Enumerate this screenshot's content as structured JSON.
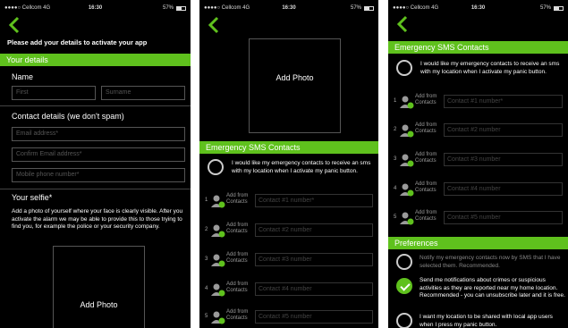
{
  "status": {
    "carrier": "●●●●○ Cellcom  4G",
    "time": "16:30",
    "battery": "57%"
  },
  "screen1": {
    "instruction": "Please add your details to activate your app",
    "details_header": "Your details",
    "name_label": "Name",
    "first_placeholder": "First",
    "surname_placeholder": "Surname",
    "contact_label": "Contact details (we don't spam)",
    "email_placeholder": "Email address*",
    "confirm_email_placeholder": "Confirm Email address*",
    "mobile_placeholder": "Mobile phone number*",
    "selfie_label": "Your selfie*",
    "selfie_text": "Add a photo of yourself where your face is clearly visible. After you activate the alarm we may be able to provide this to those trying to find you, for example the police or your security company.",
    "add_photo": "Add Photo"
  },
  "screen2": {
    "add_photo": "Add Photo",
    "sms_header": "Emergency SMS Contacts",
    "sms_option": "I would like my emergency contacts to receive an sms with my location when I activate my panic button.",
    "add_from": "Add from",
    "contacts": "Contacts",
    "contact_rows": [
      {
        "num": "1",
        "placeholder": "Contact #1 number*"
      },
      {
        "num": "2",
        "placeholder": "Contact #2 number"
      },
      {
        "num": "3",
        "placeholder": "Contact #3 number"
      },
      {
        "num": "4",
        "placeholder": "Contact #4 number"
      },
      {
        "num": "5",
        "placeholder": "Contact #5 number"
      }
    ]
  },
  "screen3": {
    "sms_header": "Emergency SMS Contacts",
    "sms_option": "I would like my emergency contacts to receive an sms with my location when I activate my panic button.",
    "add_from": "Add from",
    "contacts": "Contacts",
    "contact_rows": [
      {
        "num": "1",
        "placeholder": "Contact #1 number*"
      },
      {
        "num": "2",
        "placeholder": "Contact #2 number"
      },
      {
        "num": "3",
        "placeholder": "Contact #3 number"
      },
      {
        "num": "4",
        "placeholder": "Contact #4 number"
      },
      {
        "num": "5",
        "placeholder": "Contact #5 number"
      }
    ],
    "prefs_header": "Preferences",
    "pref_notify": "Notify my emergency contacts now by SMS that I have selected them. Recommended.",
    "pref_notifications": "Send me notifications about crimes or suspicious activities as they are reported near my home location. Recommended - you can unsubscribe later and it is free.",
    "pref_location": "I want my location to be shared with local app users when I press my panic button."
  },
  "colors": {
    "accent": "#5fc11d",
    "background": "#000000"
  },
  "icons": {
    "back": "chevron-left-icon",
    "person": "person-add-icon",
    "check": "checkmark-icon"
  }
}
